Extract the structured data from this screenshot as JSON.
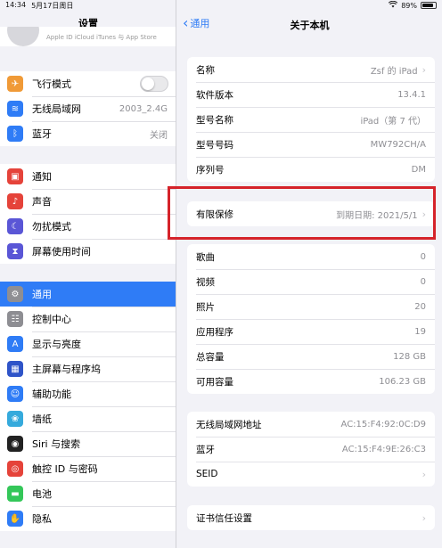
{
  "status_bar": {
    "time": "14:34",
    "date": "5月17日周日",
    "battery": "89%",
    "battery_level": 0.89
  },
  "sidebar": {
    "title": "设置",
    "profile_text": "Apple ID iCloud iTunes 与 App Store",
    "network_items": [
      {
        "label": "飞行模式",
        "value": "",
        "icon": "airplane-icon",
        "color": "#f09a37"
      },
      {
        "label": "无线局域网",
        "value": "2003_2.4G",
        "icon": "wifi-icon",
        "color": "#2f7cf6"
      },
      {
        "label": "蓝牙",
        "value": "关闭",
        "icon": "bluetooth-icon",
        "color": "#2f7cf6"
      }
    ],
    "notify_items": [
      {
        "label": "通知",
        "icon": "notifications-icon",
        "color": "#e5433a"
      },
      {
        "label": "声音",
        "icon": "sound-icon",
        "color": "#e5433a"
      },
      {
        "label": "勿扰模式",
        "icon": "moon-icon",
        "color": "#5a56d6"
      },
      {
        "label": "屏幕使用时间",
        "icon": "hourglass-icon",
        "color": "#5a56d6"
      }
    ],
    "general_items": [
      {
        "label": "通用",
        "icon": "gear-icon",
        "color": "#8e8e93"
      },
      {
        "label": "控制中心",
        "icon": "control-center-icon",
        "color": "#8e8e93"
      },
      {
        "label": "显示与亮度",
        "icon": "display-brightness-icon",
        "color": "#2f7cf6"
      },
      {
        "label": "主屏幕与程序坞",
        "icon": "home-screen-icon",
        "color": "#2f54c8"
      },
      {
        "label": "辅助功能",
        "icon": "accessibility-icon",
        "color": "#2f7cf6"
      },
      {
        "label": "墙纸",
        "icon": "wallpaper-icon",
        "color": "#35aadc"
      },
      {
        "label": "Siri 与搜索",
        "icon": "siri-icon",
        "color": "#222222"
      },
      {
        "label": "触控 ID 与密码",
        "icon": "fingerprint-icon",
        "color": "#e5433a"
      },
      {
        "label": "电池",
        "icon": "battery-icon",
        "color": "#34c759"
      },
      {
        "label": "隐私",
        "icon": "privacy-hand-icon",
        "color": "#2f7cf6"
      }
    ]
  },
  "detail": {
    "back_label": "通用",
    "title": "关于本机",
    "info": [
      {
        "label": "名称",
        "value": "Zsf 的 iPad",
        "chevron": true
      },
      {
        "label": "软件版本",
        "value": "13.4.1",
        "chevron": false
      },
      {
        "label": "型号名称",
        "value": "iPad（第 7 代）",
        "chevron": false
      },
      {
        "label": "型号号码",
        "value": "MW792CH/A",
        "chevron": false
      },
      {
        "label": "序列号",
        "value": "DM",
        "chevron": false
      }
    ],
    "warranty": {
      "label": "有限保修",
      "value": "到期日期: 2021/5/1"
    },
    "stats": [
      {
        "label": "歌曲",
        "value": "0"
      },
      {
        "label": "视频",
        "value": "0"
      },
      {
        "label": "照片",
        "value": "20"
      },
      {
        "label": "应用程序",
        "value": "19"
      },
      {
        "label": "总容量",
        "value": "128 GB"
      },
      {
        "label": "可用容量",
        "value": "106.23 GB"
      }
    ],
    "network": [
      {
        "label": "无线局域网地址",
        "value": "AC:15:F4:92:0C:D9",
        "chevron": false
      },
      {
        "label": "蓝牙",
        "value": "AC:15:F4:9E:26:C3",
        "chevron": false
      },
      {
        "label": "SEID",
        "value": "",
        "chevron": true
      }
    ],
    "cert": {
      "label": "证书信任设置"
    }
  },
  "annotation_color": "#d5232a"
}
